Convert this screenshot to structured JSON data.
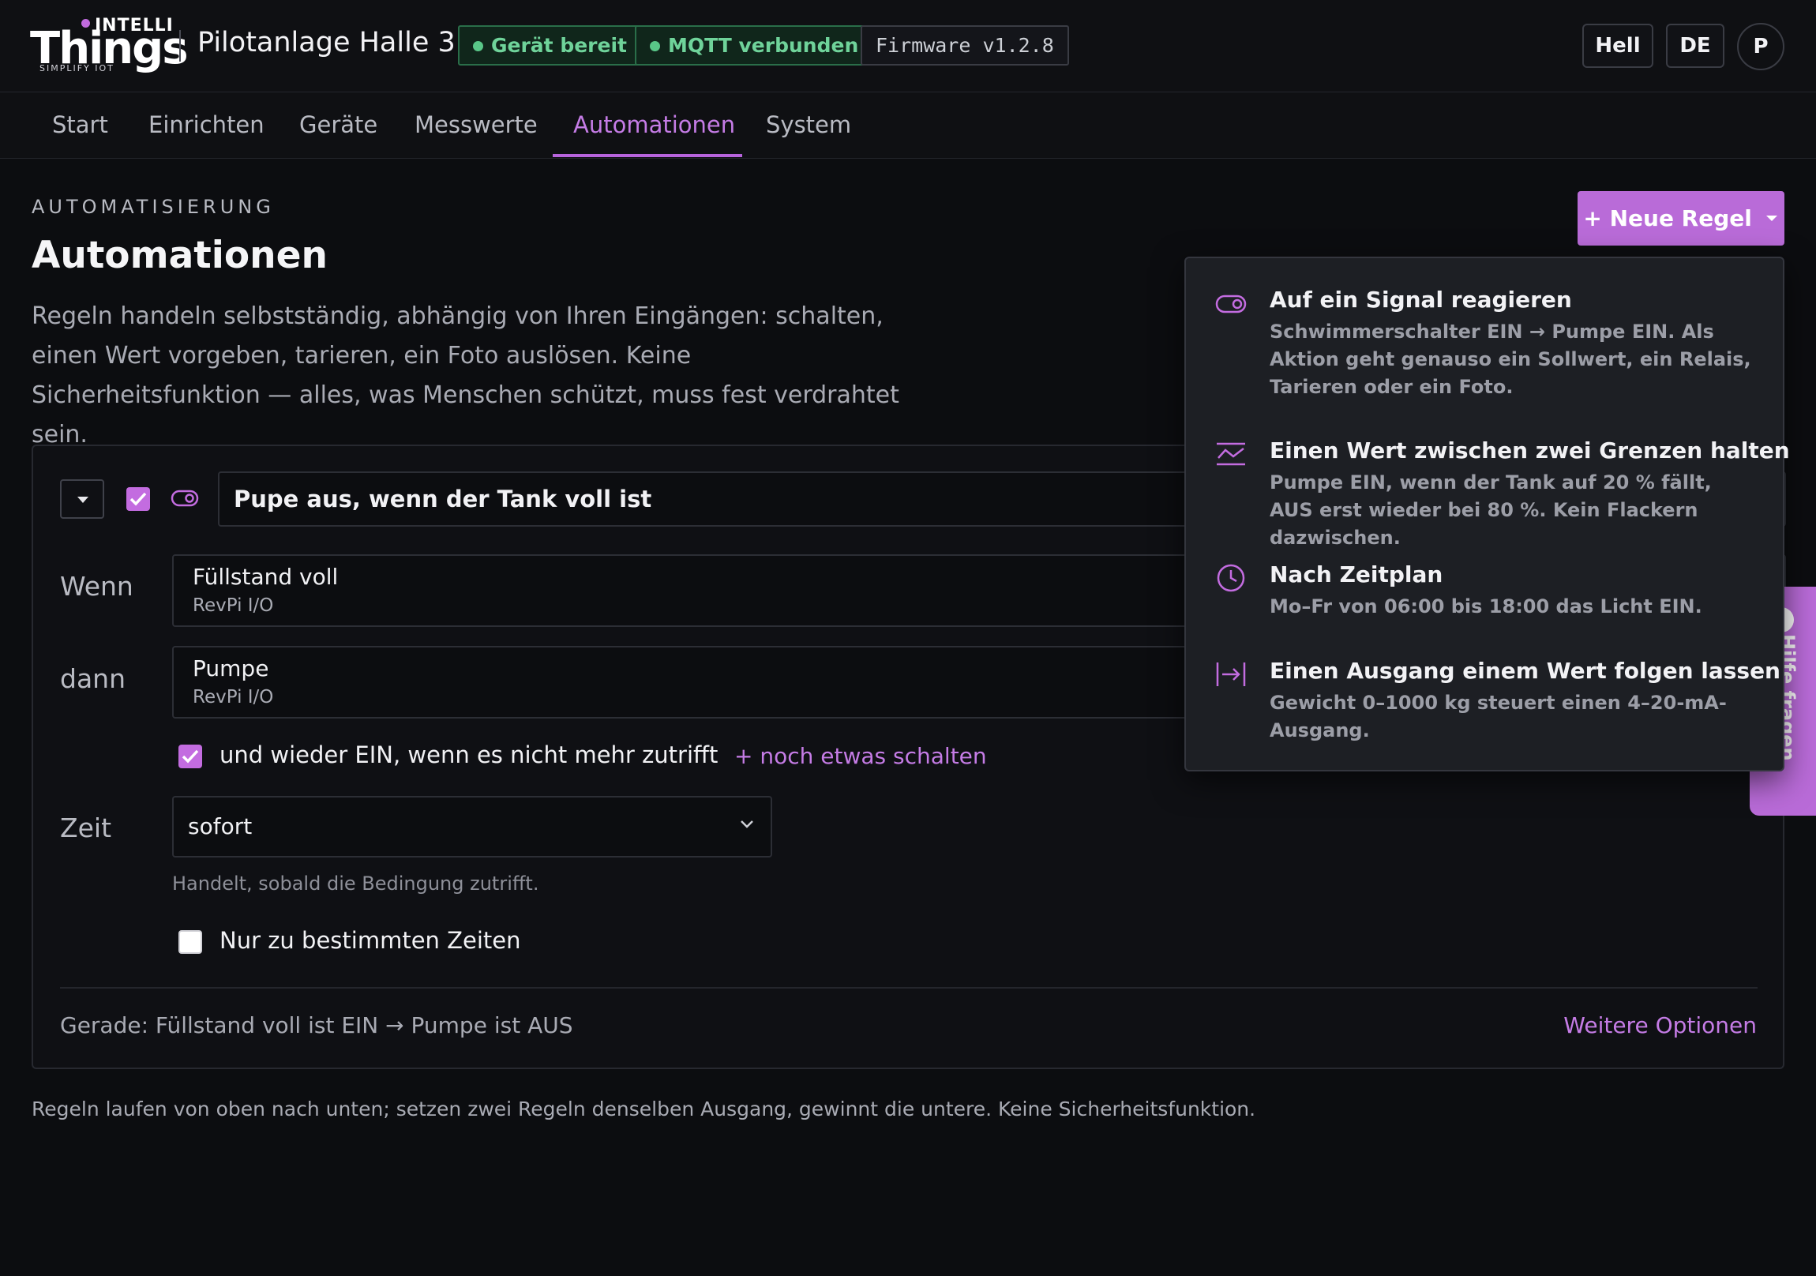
{
  "brand": {
    "intelli": "INTELLI",
    "things": "Things",
    "tagline": "SIMPLIFY IOT"
  },
  "header": {
    "site_title": "Pilotanlage Halle 3",
    "status_device": "Gerät bereit",
    "status_mqtt": "MQTT verbunden",
    "firmware": "Firmware v1.2.8",
    "theme_button": "Hell",
    "language_button": "DE",
    "avatar_initial": "P"
  },
  "nav": {
    "items": [
      "Start",
      "Einrichten",
      "Geräte",
      "Messwerte",
      "Automationen",
      "System"
    ],
    "active": "Automationen"
  },
  "page": {
    "eyebrow": "AUTOMATISIERUNG",
    "title": "Automationen",
    "lead": "Regeln handeln selbstständig, abhängig von Ihren Eingängen: schalten, einen Wert vorgeben, tarieren, ein Foto auslösen. Keine Sicherheitsfunktion — alles, was Menschen schützt, muss fest verdrahtet sein.",
    "new_rule_button": "+ Neue Regel"
  },
  "rule": {
    "name": "Pupe aus, wenn der Tank voll ist",
    "when_label": "Wenn",
    "when_value": "Füllstand voll",
    "when_source": "RevPi I/O",
    "then_label": "dann",
    "then_value": "Pumpe",
    "then_source": "RevPi I/O",
    "revert_option": "und wieder EIN, wenn es nicht mehr zutrifft",
    "add_action_link": "+ noch etwas schalten",
    "time_label": "Zeit",
    "time_value": "sofort",
    "time_hint": "Handelt, sobald die Bedingung zutrifft.",
    "schedule_option": "Nur zu bestimmten Zeiten",
    "status_line": "Gerade: Füllstand voll ist EIN → Pumpe ist AUS",
    "more_options": "Weitere Optionen"
  },
  "footnote": "Regeln laufen von oben nach unten; setzen zwei Regeln denselben Ausgang, gewinnt die untere. Keine Sicherheitsfunktion.",
  "side_tab": {
    "label": "Hilfe fragen"
  },
  "menu": {
    "items": [
      {
        "icon": "toggle-icon",
        "title": "Auf ein Signal reagieren",
        "desc": "Schwimmerschalter EIN → Pumpe EIN. Als Aktion geht genauso ein Sollwert, ein Relais, Tarieren oder ein Foto."
      },
      {
        "icon": "range-icon",
        "title": "Einen Wert zwischen zwei Grenzen halten",
        "desc": "Pumpe EIN, wenn der Tank auf 20 % fällt, AUS erst wieder bei 80 %. Kein Flackern dazwischen."
      },
      {
        "icon": "clock-icon",
        "title": "Nach Zeitplan",
        "desc": "Mo–Fr von 06:00 bis 18:00 das Licht EIN."
      },
      {
        "icon": "follow-icon",
        "title": "Einen Ausgang einem Wert folgen lassen",
        "desc": "Gewicht 0–1000 kg steuert einen 4–20-mA-Ausgang."
      }
    ]
  },
  "colors": {
    "accent": "#b96bd8",
    "ok_green": "#59c788",
    "background": "#0c0d10"
  }
}
